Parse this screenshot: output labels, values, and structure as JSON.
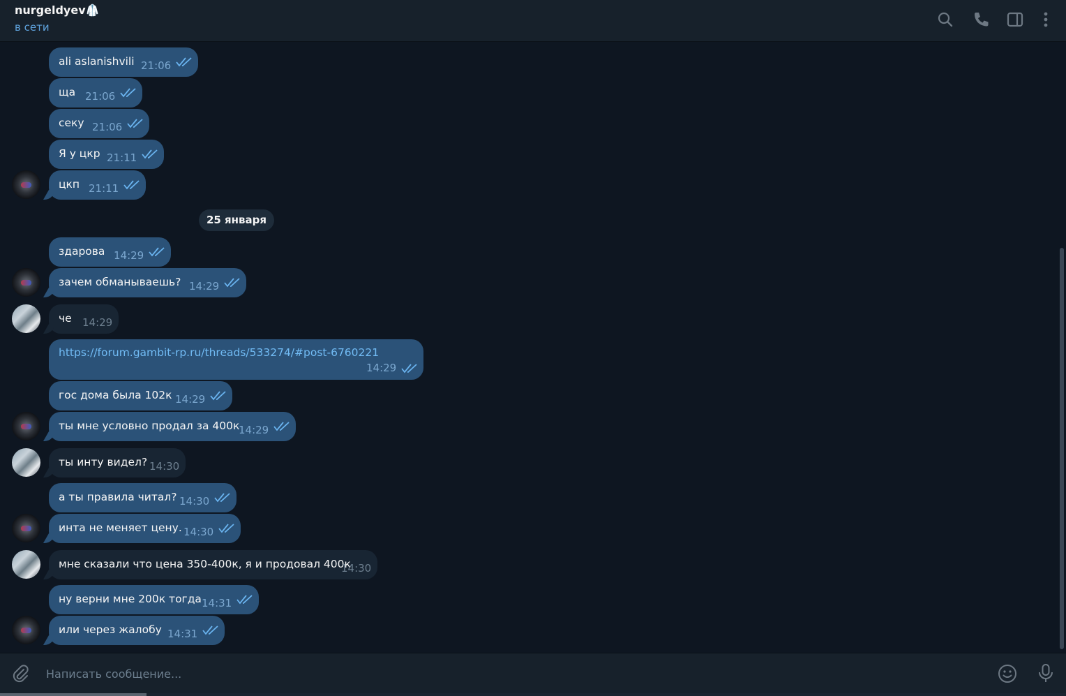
{
  "header": {
    "name": "nurgeldyev🥼",
    "status": "в сети",
    "icons": [
      "search-icon",
      "phone-icon",
      "sidebar-toggle-icon",
      "more-vertical-icon"
    ]
  },
  "messages": [
    {
      "text": "ali aslanishvili",
      "time": "21:06",
      "dir": "out"
    },
    {
      "text": "ща",
      "time": "21:06",
      "dir": "out"
    },
    {
      "text": "секу",
      "time": "21:06",
      "dir": "out"
    },
    {
      "text": "Я у цкр",
      "time": "21:11",
      "dir": "out"
    },
    {
      "text": "цкп",
      "time": "21:11",
      "dir": "out"
    },
    {
      "text": "здарова",
      "time": "14:29",
      "dir": "out"
    },
    {
      "text": "зачем обманываешь?",
      "time": "14:29",
      "dir": "out"
    },
    {
      "text": "че",
      "time": "14:29",
      "dir": "in"
    },
    {
      "text": "https://forum.gambit-rp.ru/threads/533274/#post-6760221",
      "time": "14:29",
      "dir": "out"
    },
    {
      "text": "гос дома была 102к",
      "time": "14:29",
      "dir": "out"
    },
    {
      "text": "ты мне условно продал за 400к",
      "time": "14:29",
      "dir": "out"
    },
    {
      "text": "ты инту видел?",
      "time": "14:30",
      "dir": "in"
    },
    {
      "text": "а ты правила читал?",
      "time": "14:30",
      "dir": "out"
    },
    {
      "text": "инта не меняет цену.",
      "time": "14:30",
      "dir": "out"
    },
    {
      "text": "мне сказали что цена 350-400к, я и продовал 400к",
      "time": "14:30",
      "dir": "in"
    },
    {
      "text": "ну верни мне 200к тогда",
      "time": "14:31",
      "dir": "out"
    },
    {
      "text": "или через жалобу",
      "time": "14:31",
      "dir": "out"
    }
  ],
  "date_separator": "25 января",
  "composer": {
    "placeholder": "Написать сообщение...",
    "icons": [
      "attach-icon",
      "emoji-icon",
      "microphone-icon"
    ]
  },
  "colors": {
    "background": "#0e1621",
    "header": "#17212b",
    "outgoing_bubble": "#2b5278",
    "incoming_bubble": "#182533",
    "accent": "#5fa3dd",
    "link": "#71bbf4"
  }
}
